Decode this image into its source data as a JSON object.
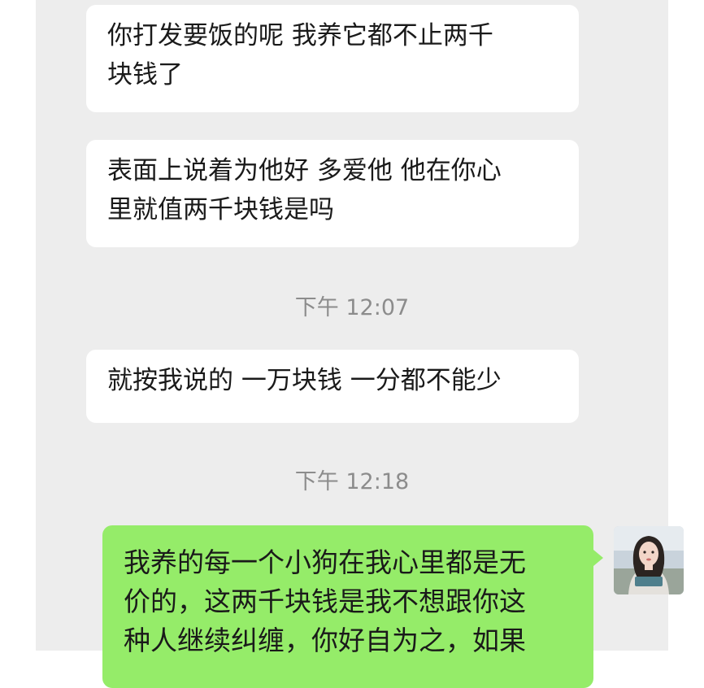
{
  "messages": [
    {
      "lines": [
        "你打发要饭的呢 我养它都不止两千",
        "块钱了"
      ]
    },
    {
      "lines": [
        "表面上说着为他好 多爱他 他在你心",
        "里就值两千块钱是吗"
      ]
    },
    {
      "lines": [
        "就按我说的 一万块钱 一分都不能少"
      ]
    },
    {
      "lines": [
        "我养的每一个小狗在我心里都是无",
        "价的，这两千块钱是我不想跟你这",
        "种人继续纠缠，你好自为之，如果"
      ]
    }
  ],
  "timestamps": [
    "下午 12:07",
    "下午 12:18"
  ],
  "colors": {
    "background": "#ededed",
    "incoming_bubble": "#ffffff",
    "outgoing_bubble": "#95ec69",
    "timestamp": "#8c8c8c"
  },
  "icons": [
    "user-avatar"
  ]
}
